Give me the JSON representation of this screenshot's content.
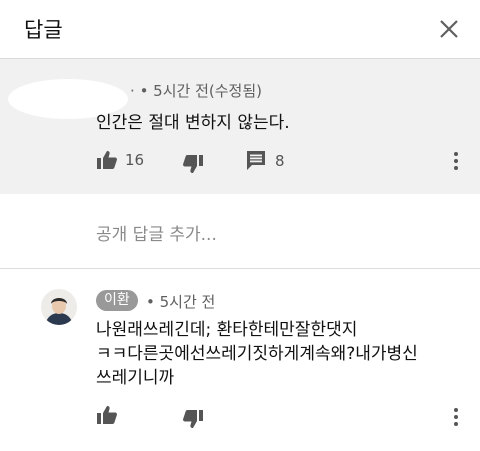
{
  "header": {
    "title": "답글"
  },
  "parent_comment": {
    "author_fragment": "·",
    "time": "• 5시간 전(수정됨)",
    "text": "인간은 절대 변하지 않는다.",
    "like_count": "16",
    "reply_count": "8"
  },
  "add_reply": {
    "placeholder": "공개 답글 추가..."
  },
  "reply": {
    "author": "이환",
    "time": "• 5시간 전",
    "lines": [
      "나원래쓰레긴데; 환타한테만잘한댓지",
      "ㅋㅋ다른곳에선쓰레기짓하게계속왜?내가병신",
      "쓰레기니까"
    ]
  },
  "colors": {
    "background": "#ffffff",
    "parent_background": "#f1f1f1",
    "chip": "#999999",
    "icon": "#555555"
  }
}
